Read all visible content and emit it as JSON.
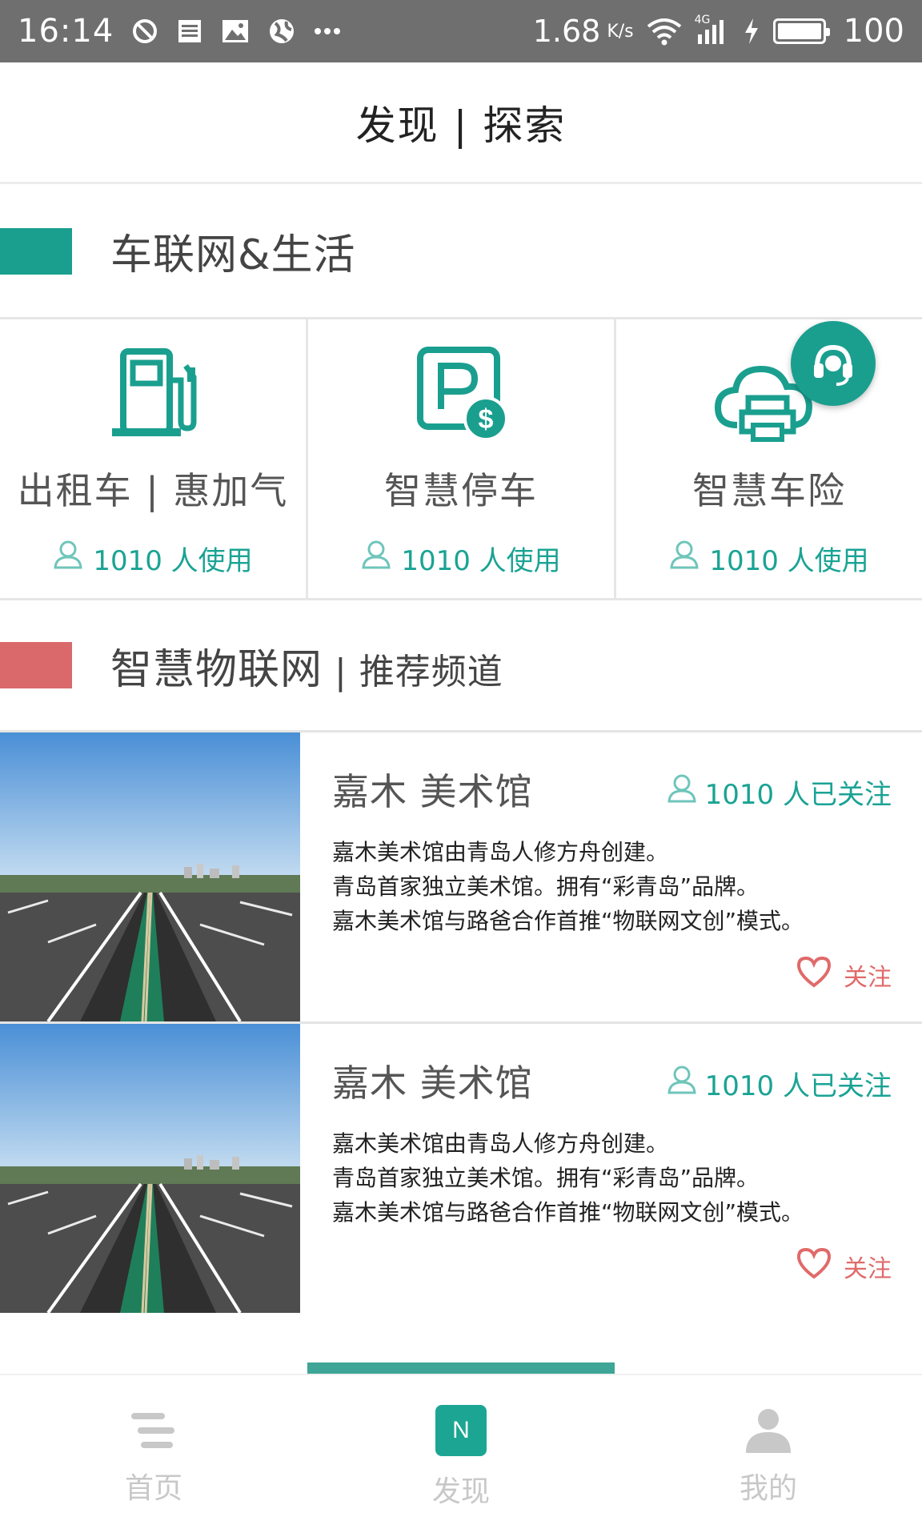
{
  "status_bar": {
    "time": "16:14",
    "speed": "1.68",
    "speed_unit": "K/s",
    "network": "4G",
    "battery": "100"
  },
  "header": {
    "title": "发现 | 探索"
  },
  "section_iov": {
    "title": "车联网&生活",
    "accent_color": "#1a9f8f"
  },
  "services": [
    {
      "name": "出租车 | 惠加气",
      "users": "1010 人使用",
      "icon": "fuel-pump-icon"
    },
    {
      "name": "智慧停车",
      "users": "1010 人使用",
      "icon": "parking-fee-icon"
    },
    {
      "name": "智慧车险",
      "users": "1010 人使用",
      "icon": "cloud-printer-icon"
    }
  ],
  "section_iot": {
    "title": "智慧物联网",
    "subtitle": " | 推荐频道",
    "accent_color": "#d9696b"
  },
  "channels": [
    {
      "title": "嘉木 美术馆",
      "followers": "1010 人已关注",
      "desc": [
        "嘉木美术馆由青岛人修方舟创建。",
        "青岛首家独立美术馆。拥有“彩青岛”品牌。",
        "嘉木美术馆与路爸合作首推“物联网文创”模式。"
      ],
      "follow_label": "关注"
    },
    {
      "title": "嘉木 美术馆",
      "followers": "1010 人已关注",
      "desc": [
        "嘉木美术馆由青岛人修方舟创建。",
        "青岛首家独立美术馆。拥有“彩青岛”品牌。",
        "嘉木美术馆与路爸合作首推“物联网文创”模式。"
      ],
      "follow_label": "关注"
    }
  ],
  "bottom_nav": {
    "items": [
      {
        "label": "首页",
        "icon": "menu-lines-icon"
      },
      {
        "label": "发现",
        "icon": "n-badge-icon",
        "badge": "N",
        "active": true
      },
      {
        "label": "我的",
        "icon": "user-icon"
      }
    ]
  },
  "colors": {
    "teal": "#1aa394",
    "red_accent": "#d9696b",
    "inactive_nav": "#c8c8c8"
  }
}
